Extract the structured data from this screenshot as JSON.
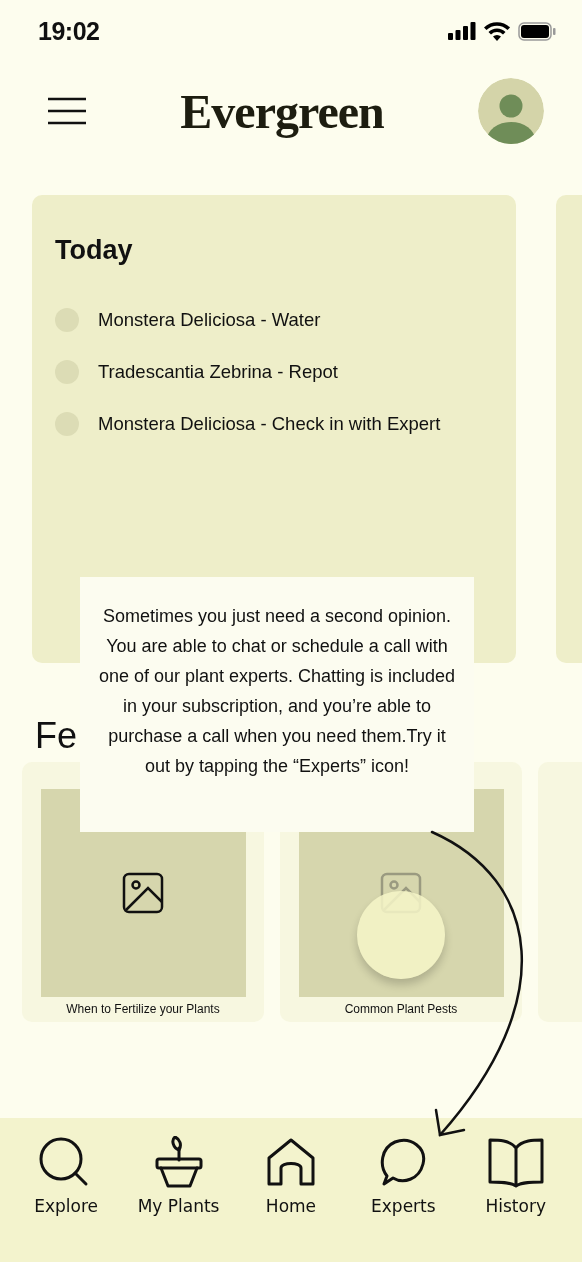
{
  "status_bar": {
    "time": "19:02"
  },
  "header": {
    "title": "Evergreen"
  },
  "today": {
    "title": "Today",
    "tasks": [
      {
        "label": "Monstera Deliciosa - Water"
      },
      {
        "label": "Tradescantia Zebrina - Repot"
      },
      {
        "label": "Monstera Deliciosa - Check in with Expert"
      }
    ]
  },
  "featured": {
    "heading": "Fe",
    "articles": [
      {
        "caption": "When to Fertilize your Plants"
      },
      {
        "caption": "Common Plant Pests"
      }
    ]
  },
  "tooltip": {
    "text": "Sometimes you just need a second opinion. You are able to chat or schedule a call with one of our plant experts. Chatting is included in your subscription, and you’re able to purchase a call when you need them.Try it out by tapping the “Experts” icon!"
  },
  "nav": [
    {
      "label": "Explore",
      "kind": "search"
    },
    {
      "label": "My Plants",
      "kind": "plant"
    },
    {
      "label": "Home",
      "kind": "home"
    },
    {
      "label": "Experts",
      "kind": "chat"
    },
    {
      "label": "History",
      "kind": "book"
    }
  ]
}
